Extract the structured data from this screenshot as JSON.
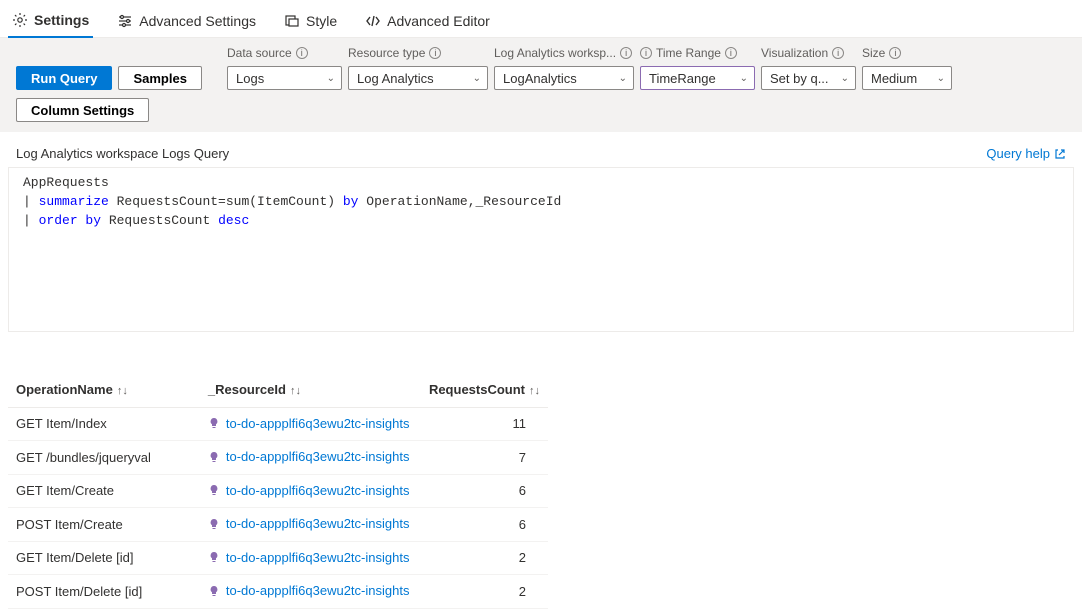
{
  "tabs": [
    {
      "label": "Settings",
      "icon": "gear"
    },
    {
      "label": "Advanced Settings",
      "icon": "sliders"
    },
    {
      "label": "Style",
      "icon": "style"
    },
    {
      "label": "Advanced Editor",
      "icon": "code"
    }
  ],
  "toolbar": {
    "run_query": "Run Query",
    "samples": "Samples",
    "column_settings": "Column Settings",
    "data_source": {
      "label": "Data source",
      "value": "Logs"
    },
    "resource_type": {
      "label": "Resource type",
      "value": "Log Analytics"
    },
    "workspace": {
      "label": "Log Analytics worksp...",
      "value": "LogAnalytics"
    },
    "time_range": {
      "label": "Time Range",
      "value": "TimeRange"
    },
    "visualization": {
      "label": "Visualization",
      "value": "Set by q..."
    },
    "size": {
      "label": "Size",
      "value": "Medium"
    }
  },
  "section_title": "Log Analytics workspace Logs Query",
  "query_help": "Query help",
  "query": {
    "line1": "AppRequests",
    "line2_pre": "| ",
    "line2_kw": "summarize",
    "line2_mid": " RequestsCount=sum(ItemCount) ",
    "line2_kw2": "by",
    "line2_end": " OperationName,_ResourceId",
    "line3_pre": "| ",
    "line3_kw": "order by",
    "line3_mid": " RequestsCount ",
    "line3_kw2": "desc"
  },
  "columns": {
    "op": "OperationName",
    "res": "_ResourceId",
    "cnt": "RequestsCount"
  },
  "rows": [
    {
      "op": "GET Item/Index",
      "res": "to-do-appplfi6q3ewu2tc-insights",
      "cnt": "11"
    },
    {
      "op": "GET /bundles/jqueryval",
      "res": "to-do-appplfi6q3ewu2tc-insights",
      "cnt": "7"
    },
    {
      "op": "GET Item/Create",
      "res": "to-do-appplfi6q3ewu2tc-insights",
      "cnt": "6"
    },
    {
      "op": "POST Item/Create",
      "res": "to-do-appplfi6q3ewu2tc-insights",
      "cnt": "6"
    },
    {
      "op": "GET Item/Delete [id]",
      "res": "to-do-appplfi6q3ewu2tc-insights",
      "cnt": "2"
    },
    {
      "op": "POST Item/Delete [id]",
      "res": "to-do-appplfi6q3ewu2tc-insights",
      "cnt": "2"
    }
  ]
}
